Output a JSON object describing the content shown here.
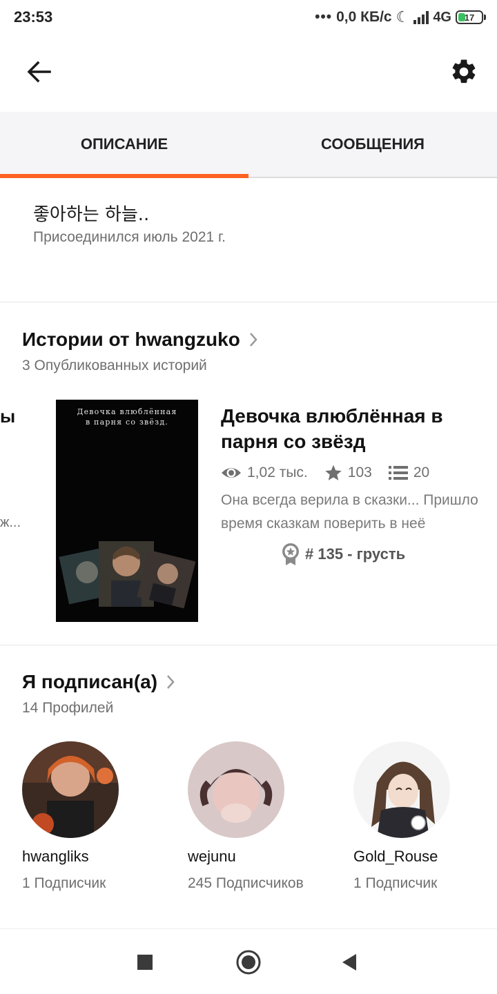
{
  "status_bar": {
    "time": "23:53",
    "dots": "•••",
    "speed": "0,0 КБ/с",
    "network": "4G",
    "battery": "17"
  },
  "tabs": [
    {
      "label": "ОПИСАНИЕ",
      "active": true
    },
    {
      "label": "СООБЩЕНИЯ",
      "active": false
    }
  ],
  "about": {
    "description": "좋아하는 하늘..",
    "joined": "Присоединился июль 2021 г."
  },
  "stories_section": {
    "title": "Истории от hwangzuko",
    "subtitle": "3 Опубликованных историй",
    "peek_title_fragment": "ы",
    "peek_text_fragment": "ж...",
    "story": {
      "cover_title_line1": "Девочка влюблённая",
      "cover_title_line2": "в парня со звёзд.",
      "title": "Девочка влюблённая в парня со звёзд",
      "reads": "1,02 тыс.",
      "votes": "103",
      "parts": "20",
      "blurb": "Она всегда верила в сказки... Пришло время сказкам поверить в неё",
      "rank": "# 135 - грусть"
    }
  },
  "following_section": {
    "title": "Я подписан(а)",
    "subtitle": "14 Профилей",
    "profiles": [
      {
        "name": "hwangliks",
        "followers": "1 Подписчик"
      },
      {
        "name": "wejunu",
        "followers": "245 Подписчиков"
      },
      {
        "name": "Gold_Rouse",
        "followers": "1 Подписчик"
      }
    ]
  },
  "colors": {
    "accent": "#ff6122",
    "tab_bg": "#f5f4f6",
    "muted_text": "#6f6f6f"
  },
  "icons": [
    "back-arrow-icon",
    "gear-icon",
    "eye-icon",
    "star-icon",
    "list-icon",
    "badge-icon",
    "chevron-right-icon",
    "stop-icon",
    "home-icon",
    "back-triangle-icon"
  ]
}
